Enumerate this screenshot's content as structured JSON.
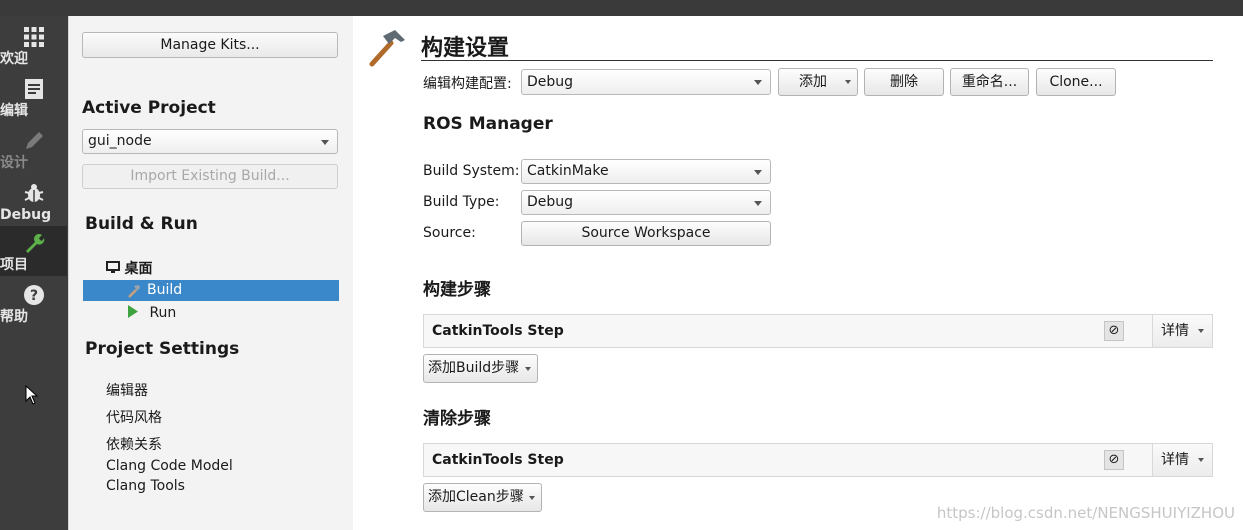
{
  "modebar": {
    "items": [
      {
        "label": "欢迎",
        "icon": "grid-icon"
      },
      {
        "label": "编辑",
        "icon": "document-icon"
      },
      {
        "label": "设计",
        "icon": "pencil-icon"
      },
      {
        "label": "Debug",
        "icon": "bug-icon"
      },
      {
        "label": "项目",
        "icon": "wrench-icon"
      },
      {
        "label": "帮助",
        "icon": "help-icon"
      }
    ]
  },
  "sidebar": {
    "manage_kits": "Manage Kits...",
    "active_project_heading": "Active Project",
    "project_value": "gui_node",
    "import_build": "Import Existing Build...",
    "build_run_heading": "Build & Run",
    "kit_name": "桌面",
    "build": "Build",
    "run": "Run",
    "project_settings_heading": "Project Settings",
    "settings": [
      "编辑器",
      "代码风格",
      "依赖关系",
      "Clang Code Model",
      "Clang Tools"
    ]
  },
  "main": {
    "title": "构建设置",
    "edit_config_label": "编辑构建配置:",
    "config_value": "Debug",
    "add_label": "添加",
    "delete_label": "删除",
    "rename_label": "重命名...",
    "clone_label": "Clone...",
    "ros_heading": "ROS Manager",
    "build_system_label": "Build System:",
    "build_system_value": "CatkinMake",
    "build_type_label": "Build Type:",
    "build_type_value": "Debug",
    "source_label": "Source:",
    "source_button": "Source Workspace",
    "build_steps_heading": "构建步骤",
    "build_step_name": "CatkinTools Step",
    "details_label": "详情",
    "add_build_step": "添加Build步骤",
    "clean_steps_heading": "清除步骤",
    "clean_step_name": "CatkinTools Step",
    "add_clean_step": "添加Clean步骤"
  },
  "watermark": "https://blog.csdn.net/NENGSHUIYIZHOU",
  "colors": {
    "selection": "#3a87c9",
    "modebar": "#3d3d3d",
    "run_triangle": "#3fa33f"
  }
}
